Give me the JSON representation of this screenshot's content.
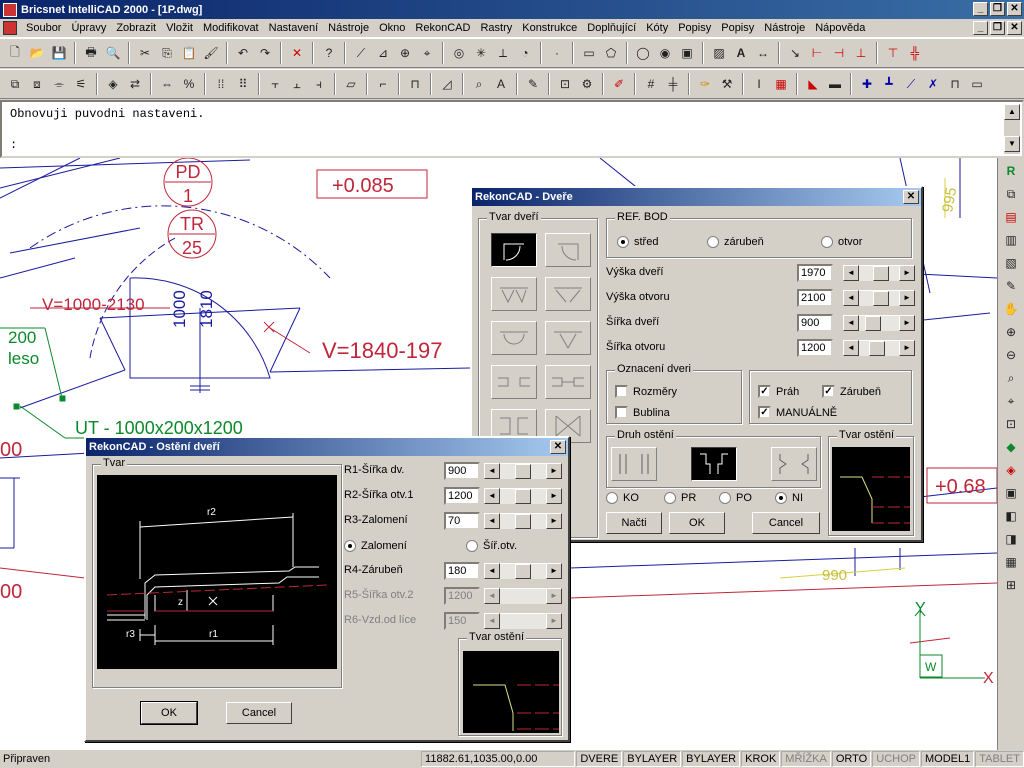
{
  "window": {
    "title": "Bricsnet IntelliCAD 2000 - [1P.dwg]",
    "controls": [
      "_",
      "❐",
      "✕"
    ]
  },
  "menu": {
    "items": [
      "Soubor",
      "Úpravy",
      "Zobrazit",
      "Vložit",
      "Modifikovat",
      "Nastavení",
      "Nástroje",
      "Okno",
      "RekonCAD",
      "Rastry",
      "Konstrukce",
      "Doplňující",
      "Kóty",
      "Popisy",
      "Popisy",
      "Nástroje",
      "Nápověda"
    ]
  },
  "command": {
    "line1": "Obnovuji puvodni nastaveni.",
    "line2": ":"
  },
  "drawing": {
    "labels": {
      "pd_top": "PD",
      "pd_num": "1",
      "tr_top": "TR",
      "tr_num": "25",
      "level1": "+0.085",
      "v1": "V=1000-2130",
      "v2": "V=1840-197",
      "dim1000": "1000",
      "dim1810": "1810",
      "left200": "200",
      "leso": "leso",
      "ut": "UT - 1000x200x1200",
      "d200a": "00",
      "d200b": "00",
      "level2": "+0.68",
      "dim990": "990",
      "dim995": "995",
      "axis_y": "Y",
      "axis_w": "W",
      "axis_x": "X"
    }
  },
  "dlg_dvere": {
    "title": "RekonCAD - Dveře",
    "group_tvar": "Tvar dveří",
    "group_ref": "REF. BOD",
    "ref_options": [
      "střed",
      "zárubeň",
      "otvor"
    ],
    "ref_selected": 0,
    "fields": [
      {
        "label": "Výška dveří",
        "value": "1970",
        "knob": 0.55
      },
      {
        "label": "Výška otvoru",
        "value": "2100",
        "knob": 0.55
      },
      {
        "label": "Šířka dveří",
        "value": "900",
        "knob": 0.35
      },
      {
        "label": "Šířka otvoru",
        "value": "1200",
        "knob": 0.45
      }
    ],
    "group_oznaceni": "Oznacení dveri",
    "check_rozmery": "Rozměry",
    "check_bublina": "Bublina",
    "check_prah": "Práh",
    "check_zarubne": "Zárubeň",
    "check_manualne": "MANUÁLNĚ",
    "checked_prah": true,
    "checked_zarubne": true,
    "checked_manualne": true,
    "group_druh": "Druh ostění",
    "group_tvar_osteni": "Tvar ostění",
    "radio_types": [
      "KO",
      "PR",
      "PO",
      "NI"
    ],
    "radio_selected": 3,
    "btn_nacti": "Načti",
    "btn_ok": "OK",
    "btn_cancel": "Cancel"
  },
  "dlg_osteni": {
    "title": "RekonCAD - Ostění dveří",
    "group_tvar": "Tvar",
    "fields": [
      {
        "label": "R1-Šířka dv.",
        "value": "900",
        "disabled": false,
        "knob": 0.5
      },
      {
        "label": "R2-Šířka otv.1",
        "value": "1200",
        "disabled": false,
        "knob": 0.5
      },
      {
        "label": "R3-Zalomení",
        "value": "70",
        "disabled": false,
        "knob": 0.5
      },
      {
        "label": "R4-Zárubeň",
        "value": "180",
        "disabled": false,
        "knob": 0.5
      },
      {
        "label": "R5-Šířka otv.2",
        "value": "1200",
        "disabled": true,
        "knob": 0.5
      },
      {
        "label": "R6-Vzd.od líce",
        "value": "150",
        "disabled": true,
        "knob": 0.5
      }
    ],
    "radio_zalomeni": "Zalomení",
    "radio_sir": "Šíř.otv.",
    "radio_selected": 0,
    "group_tvar_osteni": "Tvar ostění",
    "preview_labels": {
      "r1": "r1",
      "r2": "r2",
      "r3": "r3",
      "z": "z"
    },
    "btn_ok": "OK",
    "btn_cancel": "Cancel"
  },
  "status": {
    "message": "Připraven",
    "coords": "11882.61,1035.00,0.00",
    "items": [
      {
        "text": "DVERE",
        "dim": false
      },
      {
        "text": "BYLAYER",
        "dim": false
      },
      {
        "text": "BYLAYER",
        "dim": false
      },
      {
        "text": "KROK",
        "dim": false
      },
      {
        "text": "MŘÍŽKA",
        "dim": true
      },
      {
        "text": "ORTO",
        "dim": false
      },
      {
        "text": "UCHOP",
        "dim": true
      },
      {
        "text": "MODEL1",
        "dim": false
      },
      {
        "text": "TABLET",
        "dim": true
      }
    ]
  },
  "colors": {
    "title_blue": "#0a246a",
    "cad_red": "#c0263a",
    "cad_blue": "#1a1aa0",
    "cad_green": "#0a8a2a",
    "cad_yellow": "#d8d040"
  }
}
